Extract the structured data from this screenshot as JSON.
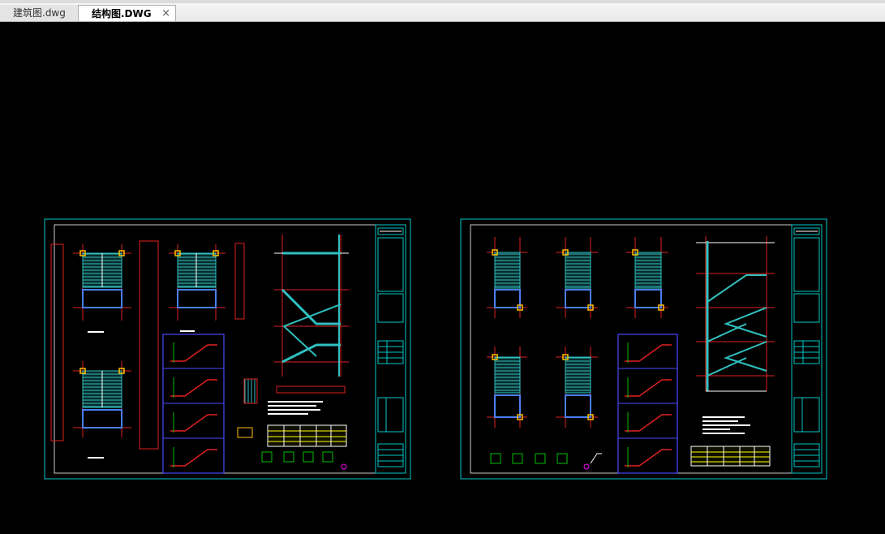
{
  "tabs": [
    {
      "label": "建筑图.dwg",
      "active": false
    },
    {
      "label": "结构图.DWG",
      "active": true
    }
  ],
  "close_glyph": "×",
  "colors": {
    "background": "#000000",
    "frame": "#00c8c8",
    "axis": "#e02020",
    "member": "#4a7ff0",
    "hatch": "#30c0c0",
    "text": "#ffffff",
    "note": "#ffff00"
  }
}
